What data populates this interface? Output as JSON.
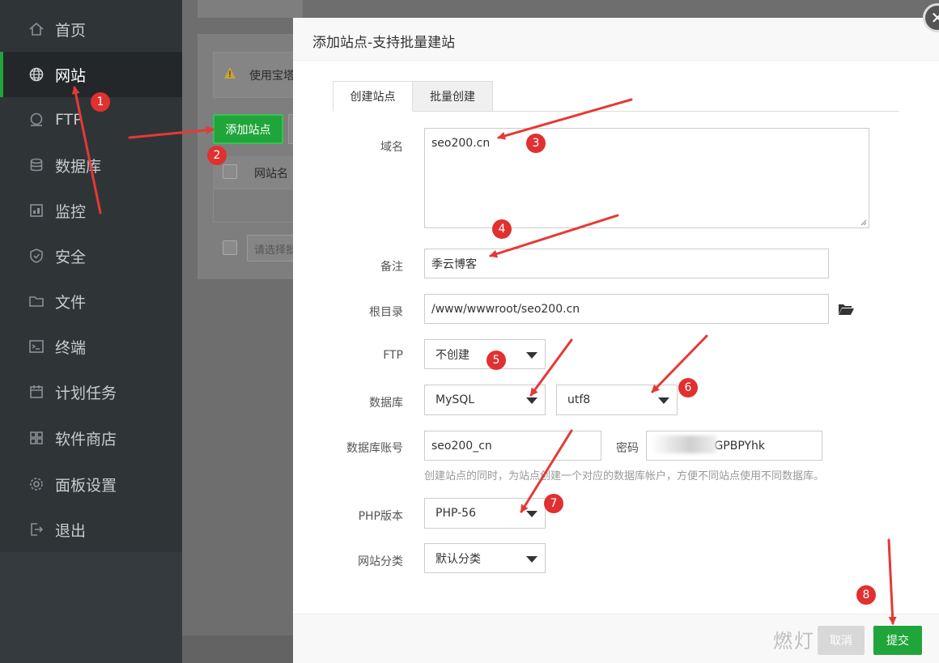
{
  "sidebar": {
    "items": [
      {
        "label": "首页",
        "icon": "home-icon"
      },
      {
        "label": "网站",
        "icon": "globe-icon",
        "active": true
      },
      {
        "label": "FTP",
        "icon": "ftp-icon"
      },
      {
        "label": "数据库",
        "icon": "database-icon"
      },
      {
        "label": "监控",
        "icon": "monitor-icon"
      },
      {
        "label": "安全",
        "icon": "shield-icon"
      },
      {
        "label": "文件",
        "icon": "folder-icon"
      },
      {
        "label": "终端",
        "icon": "terminal-icon"
      },
      {
        "label": "计划任务",
        "icon": "calendar-icon"
      },
      {
        "label": "软件商店",
        "icon": "apps-icon"
      },
      {
        "label": "面板设置",
        "icon": "gear-icon"
      },
      {
        "label": "退出",
        "icon": "logout-icon"
      }
    ]
  },
  "background": {
    "warning_text": "使用宝塔",
    "add_site_label": "添加站点",
    "table_header_text": "网站名",
    "batch_select_placeholder": "请选择批"
  },
  "modal": {
    "title": "添加站点-支持批量建站",
    "tabs": [
      "创建站点",
      "批量创建"
    ],
    "domain_label": "域名",
    "domain_value": "seo200.cn",
    "remark_label": "备注",
    "remark_value": "季云博客",
    "root_label": "根目录",
    "root_value": "/www/wwwroot/seo200.cn",
    "ftp_label": "FTP",
    "ftp_value": "不创建",
    "db_label": "数据库",
    "db_value": "MySQL",
    "charset_value": "utf8",
    "db_account_label": "数据库账号",
    "db_account_value": "seo200_cn",
    "password_label": "密码",
    "password_value": "GPBPYhk",
    "db_hint": "创建站点的同时，为站点创建一个对应的数据库帐户，方便不同站点使用不同数据库。",
    "php_label": "PHP版本",
    "php_value": "PHP-56",
    "category_label": "网站分类",
    "category_value": "默认分类",
    "cancel_label": "取消",
    "submit_label": "提交"
  },
  "annotations": [
    "1",
    "2",
    "3",
    "4",
    "5",
    "6",
    "7",
    "8"
  ],
  "watermark": "燃灯",
  "colors": {
    "accent": "#20a53a",
    "annotation": "#e03030",
    "sidebar": "#2f3437"
  }
}
